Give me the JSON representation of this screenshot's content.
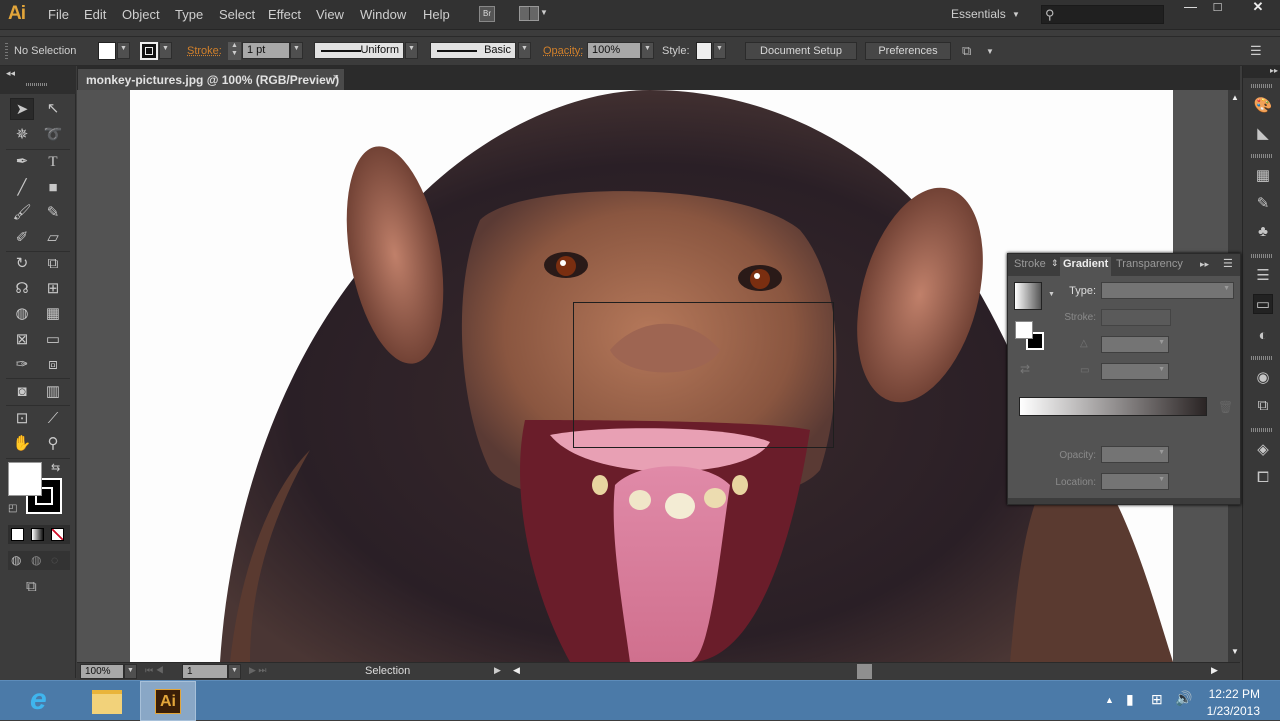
{
  "app": {
    "logo": "Ai",
    "name": "Adobe Illustrator"
  },
  "menu": {
    "items": [
      "File",
      "Edit",
      "Object",
      "Type",
      "Select",
      "Effect",
      "View",
      "Window",
      "Help"
    ],
    "bridge": "Br"
  },
  "workspace": {
    "label": "Essentials",
    "search_placeholder": ""
  },
  "window_controls": {
    "minimize": "—",
    "maximize": "□",
    "close": "✕"
  },
  "control_bar": {
    "selection_status": "No Selection",
    "stroke_label": "Stroke:",
    "stroke_weight": "1 pt",
    "profile": "Uniform",
    "brush": "Basic",
    "opacity_label": "Opacity:",
    "opacity_value": "100%",
    "style_label": "Style:",
    "document_setup": "Document Setup",
    "preferences": "Preferences"
  },
  "document": {
    "tab_title": "monkey-pictures.jpg @ 100% (RGB/Preview)",
    "close": "×"
  },
  "status_bar": {
    "zoom": "100%",
    "artboard": "1",
    "tool_status": "Selection"
  },
  "gradient_panel": {
    "tabs": [
      "Stroke",
      "Gradient",
      "Transparency"
    ],
    "active_tab": "Gradient",
    "type_label": "Type:",
    "stroke_label": "Stroke:",
    "opacity_label": "Opacity:",
    "location_label": "Location:",
    "type_value": "",
    "ramp": {
      "start": "#ffffff",
      "end": "#2a2424"
    }
  },
  "taskbar": {
    "apps": [
      "internet-explorer",
      "file-explorer",
      "adobe-illustrator"
    ],
    "active_app": "adobe-illustrator",
    "time": "12:22 PM",
    "date": "1/23/2013"
  },
  "colors": {
    "accent_orange": "#d1802b",
    "ai_logo": "#e2a53a",
    "taskbar": "#4b7aa8"
  }
}
